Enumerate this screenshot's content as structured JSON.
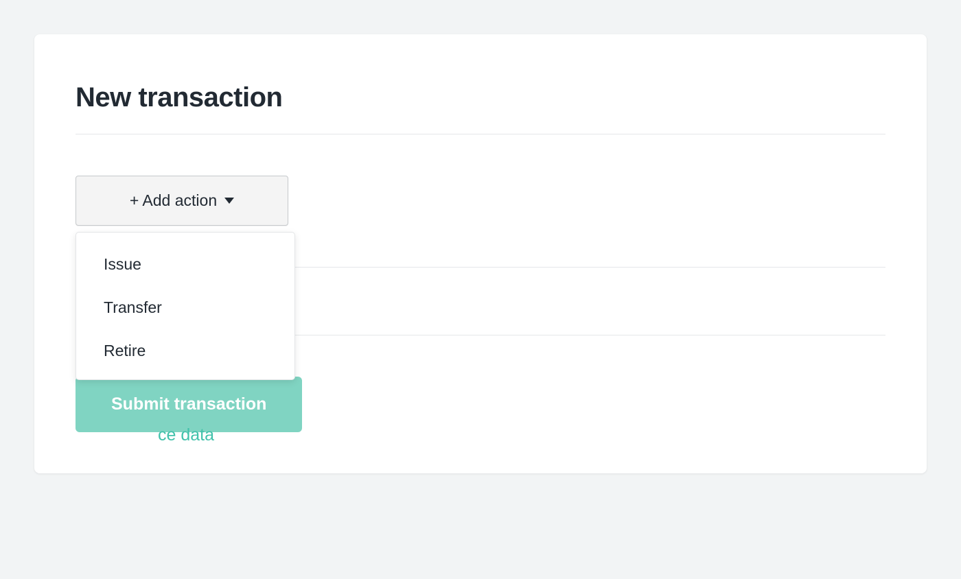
{
  "title": "New transaction",
  "add_action": {
    "label": "+ Add action"
  },
  "dropdown": {
    "items": [
      {
        "label": "Issue"
      },
      {
        "label": "Transfer"
      },
      {
        "label": "Retire"
      }
    ]
  },
  "reference_link": {
    "label_suffix": "ce data"
  },
  "submit": {
    "label": "Submit transaction"
  }
}
